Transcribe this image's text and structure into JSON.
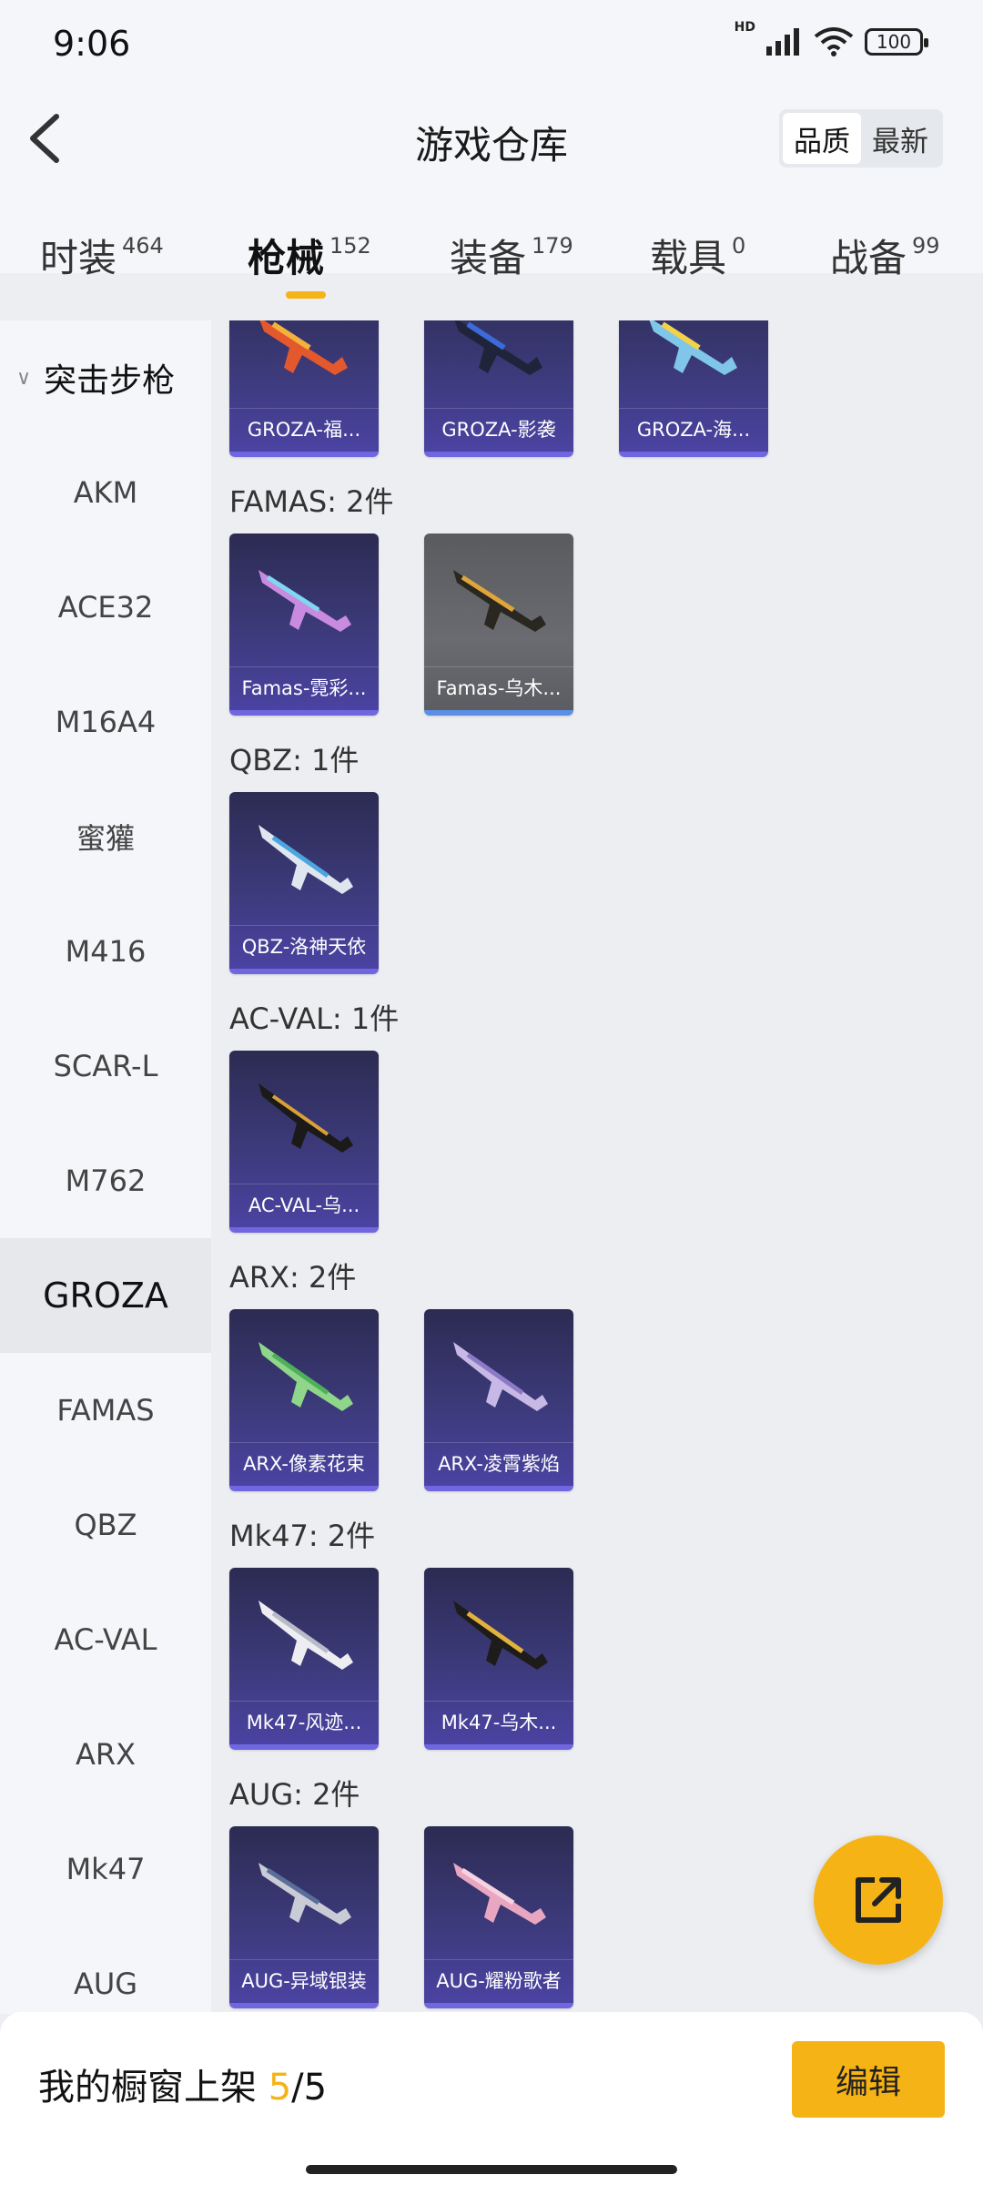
{
  "status": {
    "time": "9:06",
    "network": "HD",
    "battery": "100"
  },
  "header": {
    "title": "游戏仓库",
    "sort_quality": "品质",
    "sort_latest": "最新"
  },
  "tabs": [
    {
      "label": "时装",
      "count": "464"
    },
    {
      "label": "枪械",
      "count": "152"
    },
    {
      "label": "装备",
      "count": "179"
    },
    {
      "label": "载具",
      "count": "0"
    },
    {
      "label": "战备",
      "count": "99"
    }
  ],
  "sidebar": {
    "group": "突击步枪",
    "items": [
      "AKM",
      "ACE32",
      "M16A4",
      "蜜獾",
      "M416",
      "SCAR-L",
      "M762",
      "GROZA",
      "FAMAS",
      "QBZ",
      "AC-VAL",
      "ARX",
      "Mk47",
      "AUG"
    ]
  },
  "sections": [
    {
      "label": "",
      "items": [
        "GROZA-福...",
        "GROZA-影袭",
        "GROZA-海..."
      ]
    },
    {
      "label": "FAMAS: 2件",
      "items": [
        "Famas-霓彩...",
        "Famas-乌木..."
      ]
    },
    {
      "label": "QBZ: 1件",
      "items": [
        "QBZ-洛神天依"
      ]
    },
    {
      "label": "AC-VAL: 1件",
      "items": [
        "AC-VAL-乌..."
      ]
    },
    {
      "label": "ARX: 2件",
      "items": [
        "ARX-像素花束",
        "ARX-凌霄紫焰"
      ]
    },
    {
      "label": "Mk47: 2件",
      "items": [
        "Mk47-风迹...",
        "Mk47-乌木..."
      ]
    },
    {
      "label": "AUG: 2件",
      "items": [
        "AUG-异域银装",
        "AUG-耀粉歌者"
      ]
    }
  ],
  "bottom": {
    "shelf_label": "我的橱窗上架",
    "shelf_current": "5",
    "shelf_total": "/5",
    "edit_label": "编辑"
  },
  "colors": {
    "accent": "#f5b316",
    "card_purple": "#3c3a7a",
    "card_gray": "#6a6b70"
  },
  "icons": {
    "back": "chevron-left-icon",
    "share": "share-external-icon"
  }
}
